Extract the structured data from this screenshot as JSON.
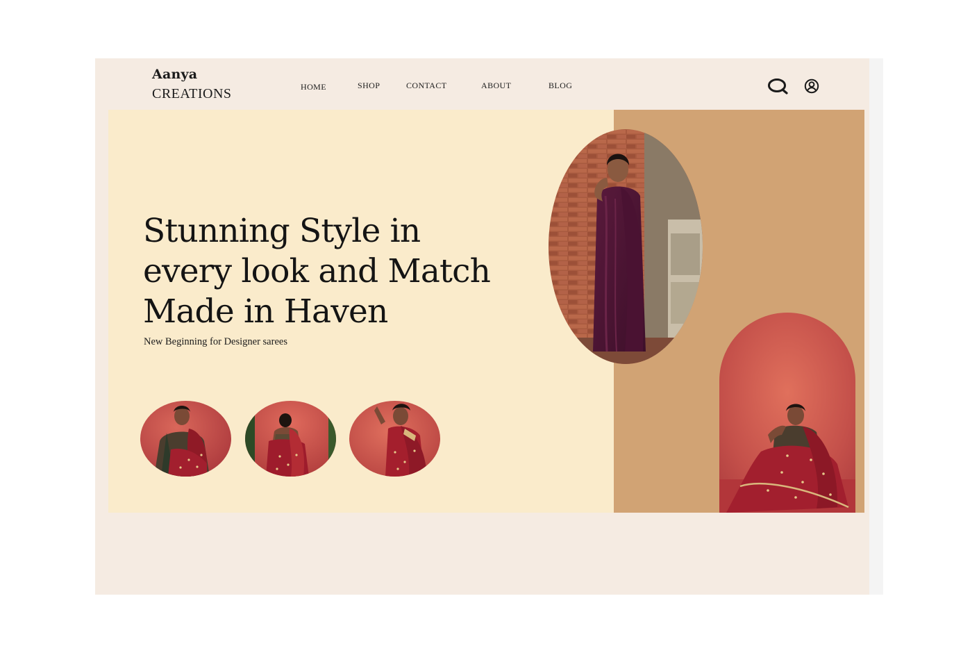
{
  "brand": {
    "line1": "Aanya",
    "line2": "CREATIONS"
  },
  "nav": {
    "items": [
      {
        "label": "HOME"
      },
      {
        "label": "SHOP"
      },
      {
        "label": "CONTACT"
      },
      {
        "label": "ABOUT"
      },
      {
        "label": "BLOG"
      }
    ]
  },
  "header_icons": {
    "search": "search-icon",
    "account": "user-circle-icon"
  },
  "hero": {
    "headline": "Stunning Style in every look and Match Made in Haven",
    "subline": "New Beginning for Designer sarees"
  },
  "colors": {
    "page_bg": "#f5ebe2",
    "hero_left_bg": "#faebcb",
    "hero_right_bg": "#d1a374",
    "text": "#141414"
  }
}
